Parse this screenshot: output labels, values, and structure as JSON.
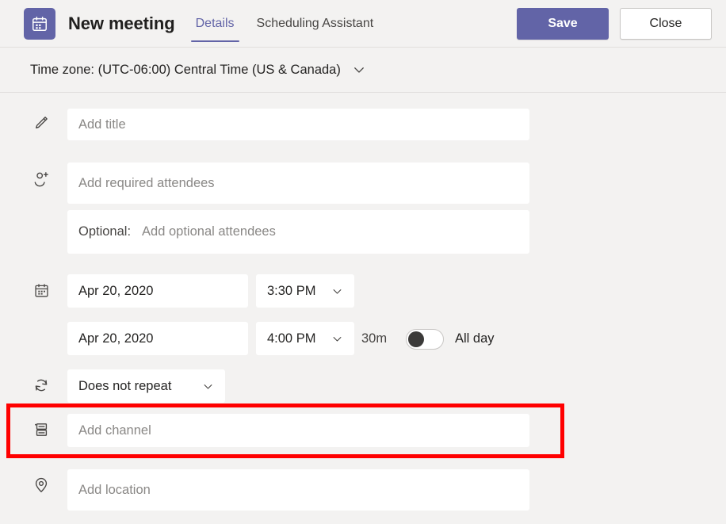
{
  "header": {
    "app_icon": "calendar-icon",
    "title": "New meeting",
    "tabs": [
      {
        "label": "Details",
        "active": true
      },
      {
        "label": "Scheduling Assistant",
        "active": false
      }
    ],
    "save_label": "Save",
    "close_label": "Close",
    "accent_color": "#6264a7"
  },
  "timezone": {
    "label": "Time zone:",
    "value": "(UTC-06:00) Central Time (US & Canada)",
    "full_text": "Time zone: (UTC-06:00) Central Time (US & Canada)",
    "chevron": "chevron-down-icon"
  },
  "form": {
    "title_field": {
      "icon": "pencil-icon",
      "placeholder": "Add title",
      "value": ""
    },
    "required_attendees": {
      "icon": "person-add-icon",
      "placeholder": "Add required attendees",
      "value": ""
    },
    "optional_attendees": {
      "label": "Optional:",
      "placeholder": "Add optional attendees",
      "value": ""
    },
    "start": {
      "icon": "calendar-icon",
      "date": "Apr 20, 2020",
      "time": "3:30 PM",
      "chevron": "chevron-down-icon"
    },
    "end": {
      "date": "Apr 20, 2020",
      "time": "4:00 PM",
      "chevron": "chevron-down-icon"
    },
    "duration": "30m",
    "all_day": {
      "label": "All day",
      "enabled": false
    },
    "repeat": {
      "icon": "repeat-icon",
      "value": "Does not repeat",
      "chevron": "chevron-down-icon"
    },
    "channel": {
      "icon": "channel-icon",
      "placeholder": "Add channel",
      "value": ""
    },
    "location": {
      "icon": "location-pin-icon",
      "placeholder": "Add location",
      "value": ""
    }
  },
  "annotation": {
    "target": "channel-row",
    "color": "#ff0000"
  }
}
